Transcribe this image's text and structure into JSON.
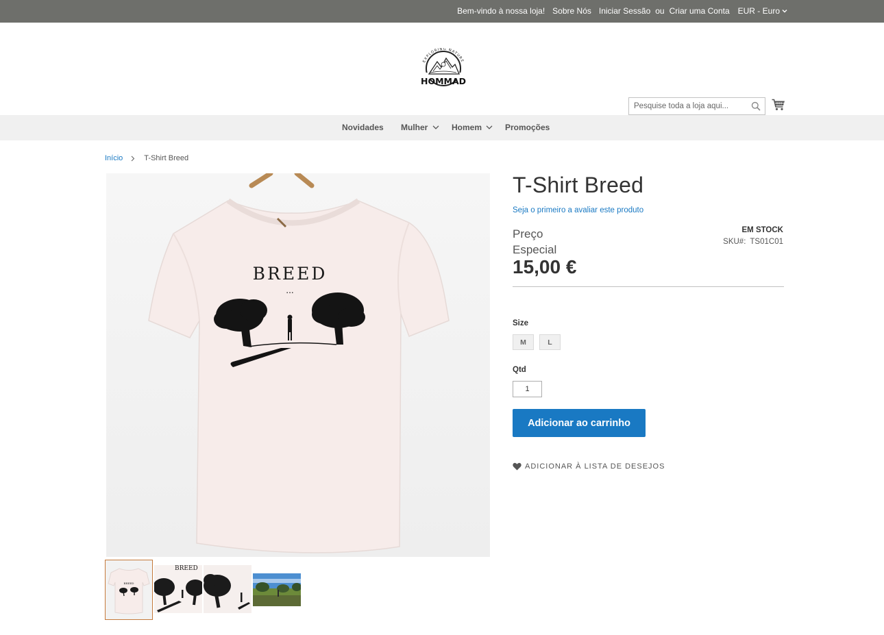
{
  "topbar": {
    "welcome": "Bem-vindo à nossa loja!",
    "about": "Sobre Nós",
    "signin": "Iniciar Sessão",
    "or": "ou",
    "create_account": "Criar uma Conta",
    "currency": "EUR - Euro"
  },
  "header": {
    "logo_text": "HOMMAD",
    "logo_tagline": "EXPLORING NATURE",
    "search_placeholder": "Pesquise toda a loja aqui..."
  },
  "nav": {
    "items": [
      {
        "label": "Novidades",
        "has_dropdown": false
      },
      {
        "label": "Mulher",
        "has_dropdown": true
      },
      {
        "label": "Homem",
        "has_dropdown": true
      },
      {
        "label": "Promoções",
        "has_dropdown": false
      }
    ]
  },
  "breadcrumb": {
    "home": "Início",
    "current": "T-Shirt Breed"
  },
  "gallery": {
    "print_text": "BREED",
    "thumbnails": 4,
    "active_index": 0
  },
  "product": {
    "title": "T-Shirt Breed",
    "review_link": "Seja o primeiro a avaliar este produto",
    "price_label_line1": "Preço",
    "price_label_line2": "Especial",
    "price": "15,00 €",
    "stock": "EM STOCK",
    "sku_label": "SKU#:",
    "sku": "TS01C01",
    "size_label": "Size",
    "sizes": [
      "M",
      "L"
    ],
    "qty_label": "Qtd",
    "qty_value": "1",
    "add_to_cart": "Adicionar ao carrinho",
    "wishlist": "ADICIONAR À LISTA DE DESEJOS"
  },
  "colors": {
    "topbar": "#6e6f6b",
    "nav": "#f0f0f0",
    "accent": "#1979c3",
    "thumb_active_border": "#c57a3b"
  },
  "icons": [
    "chevron-down-icon",
    "search-icon",
    "cart-icon",
    "heart-icon",
    "chevron-right-icon"
  ]
}
